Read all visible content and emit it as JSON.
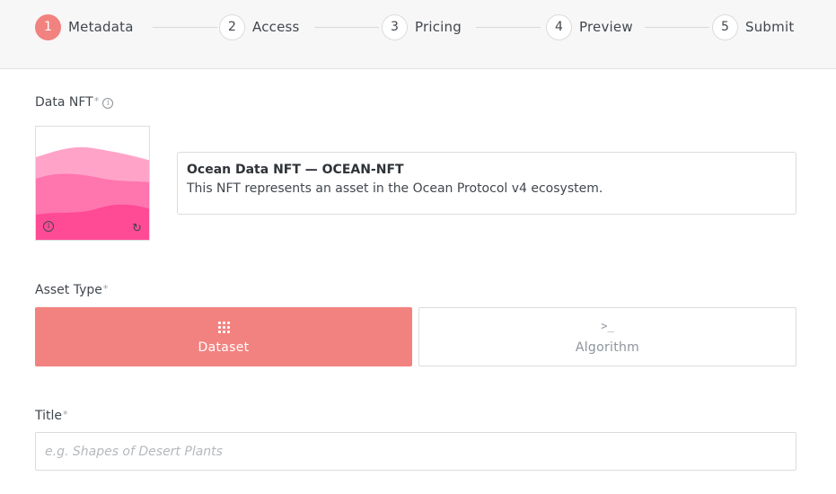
{
  "stepper": {
    "steps": [
      {
        "number": "1",
        "label": "Metadata",
        "active": true
      },
      {
        "number": "2",
        "label": "Access",
        "active": false
      },
      {
        "number": "3",
        "label": "Pricing",
        "active": false
      },
      {
        "number": "4",
        "label": "Preview",
        "active": false
      },
      {
        "number": "5",
        "label": "Submit",
        "active": false
      }
    ]
  },
  "data_nft": {
    "label": "Data NFT",
    "required_mark": "*",
    "info_icon": "info-icon",
    "image_info_icon": "info-icon",
    "refresh_icon": "refresh-icon",
    "name": "Ocean Data NFT — OCEAN-NFT",
    "description": "This NFT represents an asset in the Ocean Protocol v4 ecosystem."
  },
  "asset_type": {
    "label": "Asset Type",
    "required_mark": "*",
    "options": [
      {
        "label": "Dataset",
        "icon": "grid-dots-icon",
        "selected": true
      },
      {
        "label": "Algorithm",
        "icon": "terminal-icon",
        "icon_glyph": ">_",
        "selected": false
      }
    ]
  },
  "title": {
    "label": "Title",
    "required_mark": "*",
    "value": "",
    "placeholder": "e.g. Shapes of Desert Plants"
  },
  "colors": {
    "accent": "#f2827f",
    "nft_wave_1": "#ffa4c8",
    "nft_wave_2": "#ff75ae",
    "nft_wave_3": "#ff4a96"
  }
}
